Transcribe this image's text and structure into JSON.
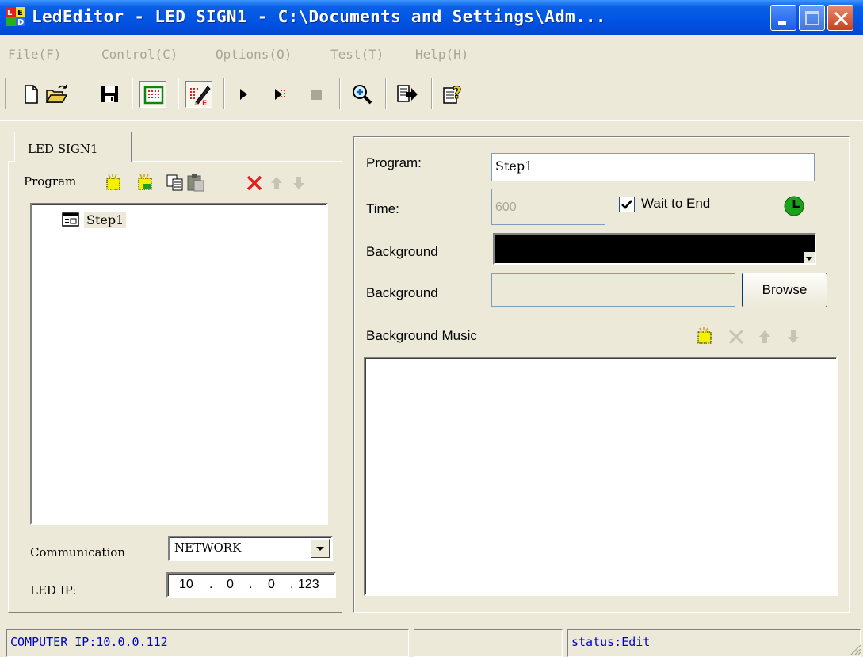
{
  "window": {
    "title": "LedEditor - LED SIGN1 - C:\\Documents and Settings\\Adm...",
    "icon": "led-app-icon",
    "minimize_icon": "minimize-icon",
    "maximize_icon": "maximize-icon",
    "close_icon": "close-icon"
  },
  "menu": {
    "items": [
      "File(F)",
      "Control(C)",
      "Options(O)",
      "Test(T)",
      "Help(H)"
    ]
  },
  "toolbar": {
    "tools": [
      "new-file-icon",
      "open-folder-icon",
      "save-icon",
      "led-screen-icon",
      "edit-icon",
      "play-icon",
      "play-step-icon",
      "stop-icon",
      "zoom-in-icon",
      "export-icon",
      "help-icon"
    ]
  },
  "left_panel": {
    "tab_label": "LED SIGN1",
    "program_label": "Program",
    "tree": {
      "items": [
        "Step1"
      ]
    },
    "communication_label": "Communication",
    "communication_value": "NETWORK",
    "led_ip_label": "LED IP:",
    "led_ip": [
      "10",
      "0",
      "0",
      "123"
    ]
  },
  "right_panel": {
    "program_label": "Program:",
    "program_value": "Step1",
    "time_label": "Time:",
    "time_value": "600",
    "wait_to_end_label": "Wait to End",
    "wait_to_end_checked": true,
    "background_label_1": "Background",
    "background_color": "#000000",
    "background_label_2": "Background",
    "browse_label": "Browse",
    "music_label": "Background Music"
  },
  "status": {
    "computer_ip": "COMPUTER IP:10.0.0.112",
    "middle": "",
    "state": "status:Edit"
  },
  "colors": {
    "titlebar": "#0054e3",
    "window_bg": "#ece9d8",
    "status_text": "#0000cc",
    "disabled_text": "#a7a595"
  }
}
